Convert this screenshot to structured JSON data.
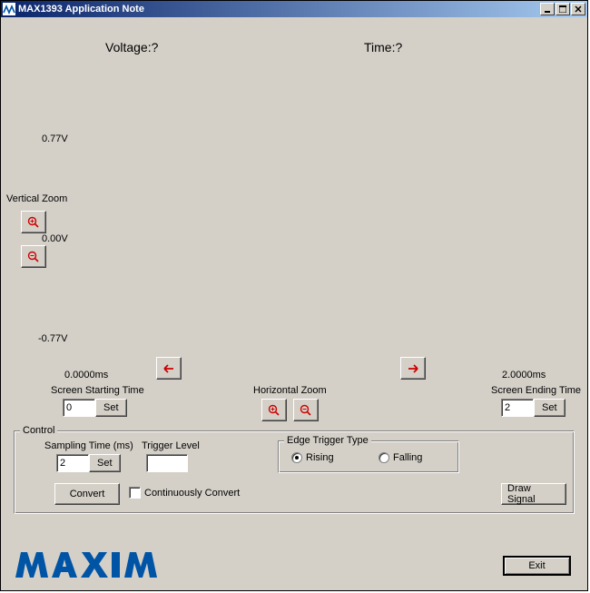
{
  "window": {
    "title": "MAX1393 Application Note"
  },
  "readout": {
    "voltage_label": "Voltage:",
    "voltage_value": "?",
    "time_label": "Time:",
    "time_value": "?"
  },
  "axis": {
    "y_top": "0.77V",
    "y_mid": "0.00V",
    "y_bot": "-0.77V",
    "x_left": "0.0000ms",
    "x_right": "2.0000ms"
  },
  "vzoom": {
    "label": "Vertical Zoom"
  },
  "hzoom": {
    "label": "Horizontal Zoom"
  },
  "screen_start": {
    "label": "Screen Starting Time",
    "value": "0",
    "set": "Set"
  },
  "screen_end": {
    "label": "Screen Ending Time",
    "value": "2",
    "set": "Set"
  },
  "control": {
    "group_label": "Control",
    "sampling_label": "Sampling Time (ms)",
    "sampling_value": "2",
    "sampling_set": "Set",
    "trigger_level_label": "Trigger Level",
    "trigger_level_value": "",
    "edge_group": "Edge Trigger Type",
    "rising": "Rising",
    "falling": "Falling",
    "convert": "Convert",
    "continuously": "Continuously Convert",
    "draw": "Draw Signal"
  },
  "buttons": {
    "exit": "Exit"
  },
  "logo": {
    "text": "MAXIM"
  }
}
